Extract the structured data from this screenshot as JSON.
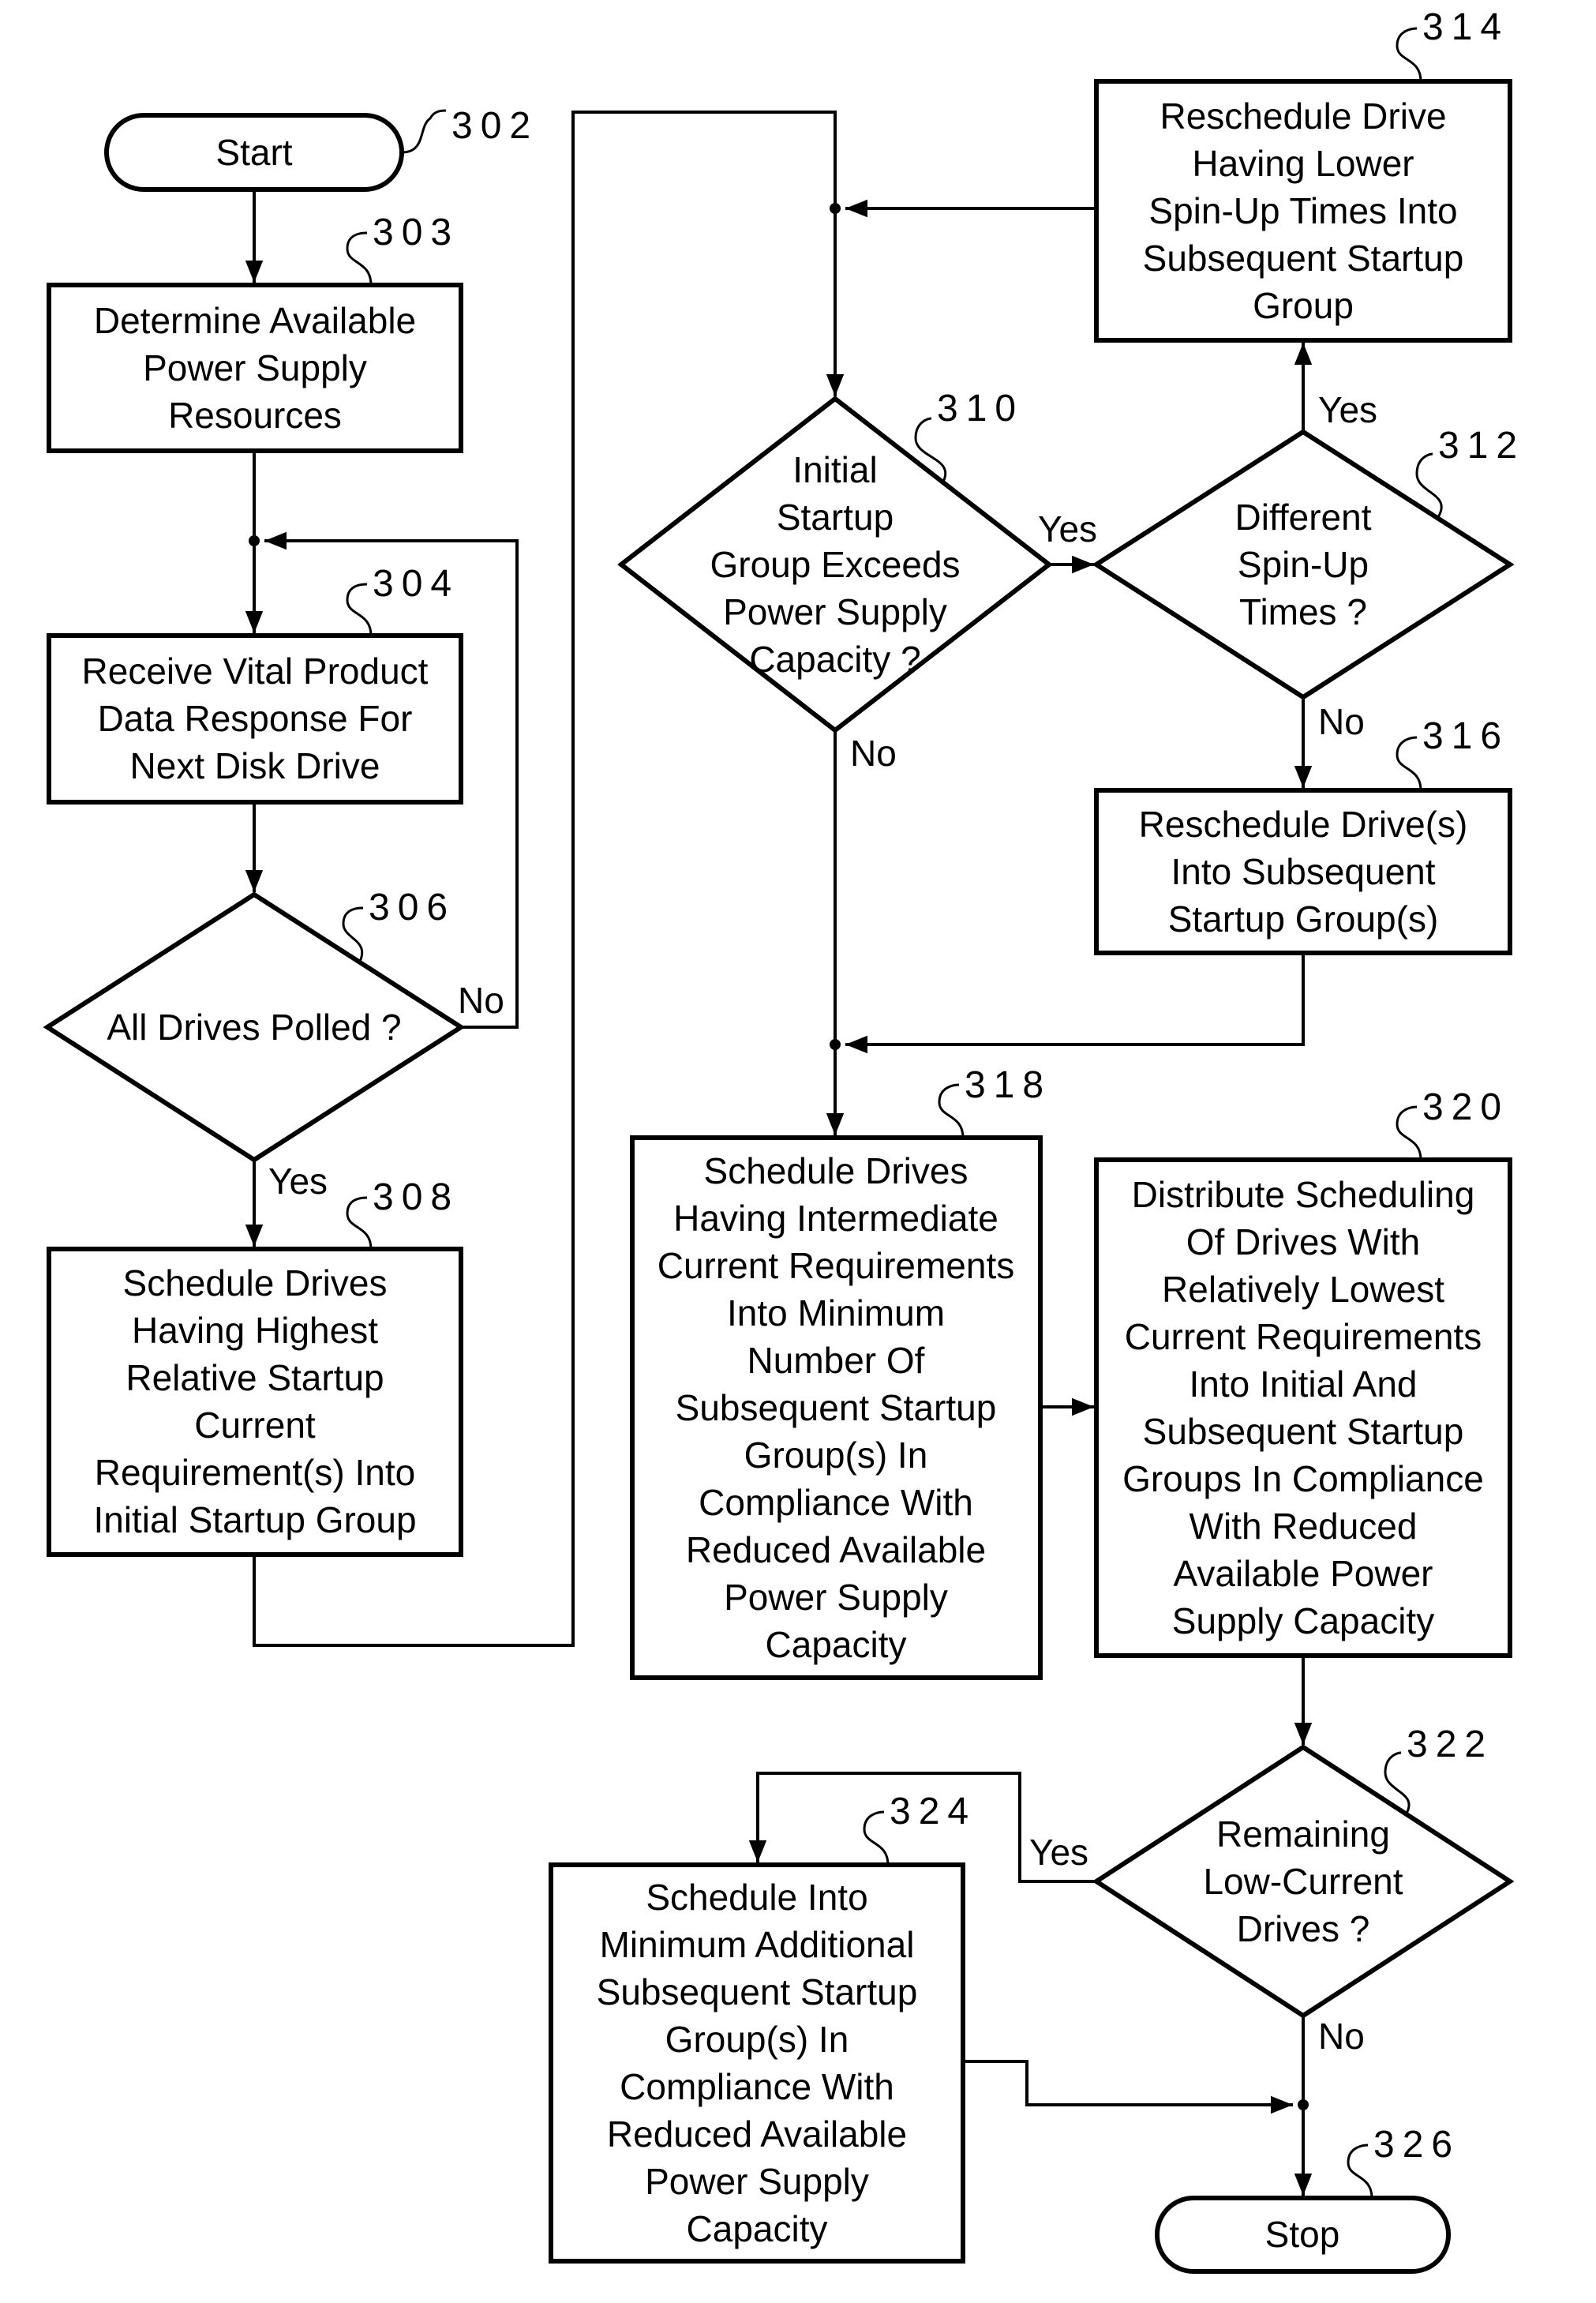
{
  "figure": {
    "nodes": {
      "n302": {
        "ref": "302",
        "type": "terminal",
        "lines": [
          "Start"
        ]
      },
      "n303": {
        "ref": "303",
        "type": "process",
        "lines": [
          "Determine Available",
          "Power Supply",
          "Resources"
        ]
      },
      "n304": {
        "ref": "304",
        "type": "process",
        "lines": [
          "Receive Vital Product",
          "Data Response For",
          "Next Disk Drive"
        ]
      },
      "n306": {
        "ref": "306",
        "type": "decision",
        "lines": [
          "All Drives Polled ?"
        ]
      },
      "n308": {
        "ref": "308",
        "type": "process",
        "lines": [
          "Schedule Drives",
          "Having Highest",
          "Relative Startup",
          "Current",
          "Requirement(s) Into",
          "Initial Startup Group"
        ]
      },
      "n310": {
        "ref": "310",
        "type": "decision",
        "lines": [
          "Initial",
          "Startup",
          "Group Exceeds",
          "Power Supply",
          "Capacity ?"
        ]
      },
      "n312": {
        "ref": "312",
        "type": "decision",
        "lines": [
          "Different",
          "Spin-Up",
          "Times ?"
        ]
      },
      "n314": {
        "ref": "314",
        "type": "process",
        "lines": [
          "Reschedule Drive",
          "Having Lower",
          "Spin-Up Times Into",
          "Subsequent Startup",
          "Group"
        ]
      },
      "n316": {
        "ref": "316",
        "type": "process",
        "lines": [
          "Reschedule Drive(s)",
          "Into Subsequent",
          "Startup Group(s)"
        ]
      },
      "n318": {
        "ref": "318",
        "type": "process",
        "lines": [
          "Schedule Drives",
          "Having Intermediate",
          "Current Requirements",
          "Into Minimum",
          "Number Of",
          "Subsequent Startup",
          "Group(s) In",
          "Compliance With",
          "Reduced Available",
          "Power Supply",
          "Capacity"
        ]
      },
      "n320": {
        "ref": "320",
        "type": "process",
        "lines": [
          "Distribute Scheduling",
          "Of Drives With",
          "Relatively Lowest",
          "Current Requirements",
          "Into Initial And",
          "Subsequent Startup",
          "Groups In Compliance",
          "With Reduced",
          "Available Power",
          "Supply Capacity"
        ]
      },
      "n322": {
        "ref": "322",
        "type": "decision",
        "lines": [
          "Remaining",
          "Low-Current",
          "Drives ?"
        ]
      },
      "n324": {
        "ref": "324",
        "type": "process",
        "lines": [
          "Schedule Into",
          "Minimum Additional",
          "Subsequent Startup",
          "Group(s) In",
          "Compliance With",
          "Reduced Available",
          "Power Supply",
          "Capacity"
        ]
      },
      "n326": {
        "ref": "326",
        "type": "terminal",
        "lines": [
          "Stop"
        ]
      }
    },
    "edge_labels": {
      "e306_no": "No",
      "e306_yes": "Yes",
      "e310_yes": "Yes",
      "e310_no": "No",
      "e312_yes": "Yes",
      "e312_no": "No",
      "e322_yes": "Yes",
      "e322_no": "No"
    },
    "colors": {
      "ink": "#000000",
      "paper": "#ffffff"
    }
  }
}
